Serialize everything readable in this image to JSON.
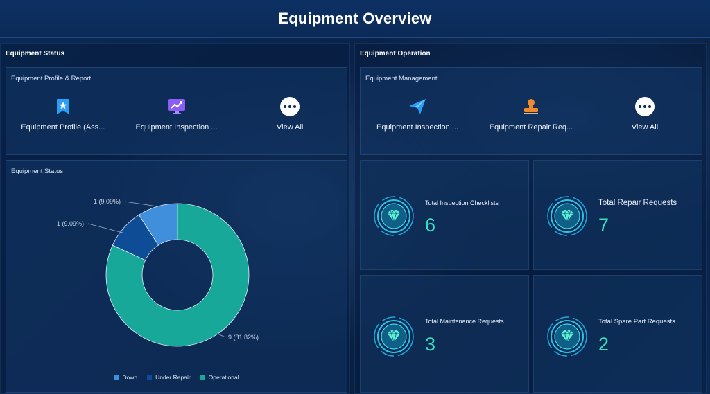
{
  "header": {
    "title": "Equipment Overview"
  },
  "left_section": {
    "title": "Equipment Status",
    "profile_card": {
      "title": "Equipment Profile & Report",
      "items": [
        {
          "label": "Equipment Profile (Ass...",
          "icon": "bookmark-star-icon"
        },
        {
          "label": "Equipment Inspection ...",
          "icon": "monitor-chart-icon"
        },
        {
          "label": "View All",
          "icon": "more-dots-icon"
        }
      ]
    },
    "status_card": {
      "title": "Equipment Status"
    }
  },
  "right_section": {
    "title": "Equipment Operation",
    "management_card": {
      "title": "Equipment Management",
      "items": [
        {
          "label": "Equipment Inspection ...",
          "icon": "paper-plane-icon"
        },
        {
          "label": "Equipment Repair Req...",
          "icon": "stamp-icon"
        },
        {
          "label": "View All",
          "icon": "more-dots-icon"
        }
      ]
    },
    "stats": [
      {
        "label": "Total Inspection Checklists",
        "value": "6"
      },
      {
        "label": "Total Repair Requests",
        "value": "7"
      },
      {
        "label": "Total Maintenance Requests",
        "value": "3"
      },
      {
        "label": "Total Spare Part Requests",
        "value": "2"
      }
    ]
  },
  "colors": {
    "down": "#3f8fdc",
    "under_repair": "#0f4c96",
    "operational": "#17a89a",
    "stat_value": "#35e2c0",
    "accent_purple": "#8b5cf6",
    "accent_orange": "#f08a2c",
    "accent_blue": "#2a9df4"
  },
  "chart_data": {
    "type": "pie",
    "donut": true,
    "categories": [
      "Down",
      "Under Repair",
      "Operational"
    ],
    "values": [
      1,
      1,
      9
    ],
    "data_labels": [
      "1 (9.09%)",
      "1 (9.09%)",
      "9 (81.82%)"
    ],
    "legend_position": "bottom"
  }
}
